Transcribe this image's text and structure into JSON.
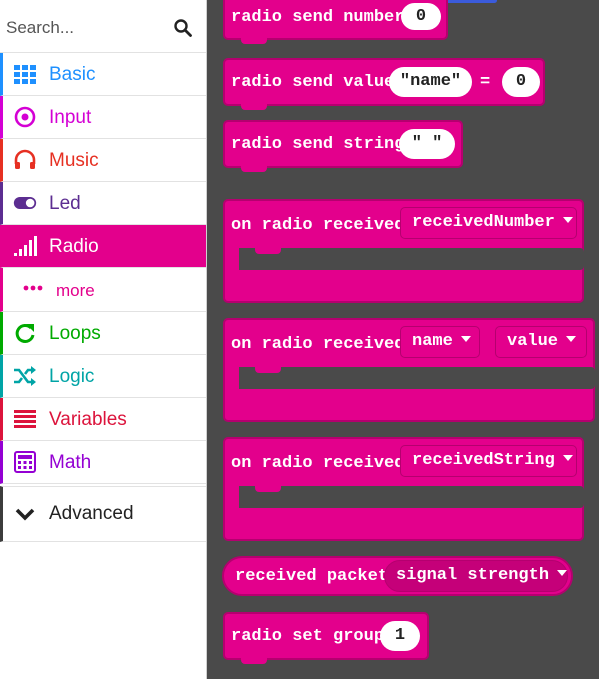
{
  "toolbox": {
    "search_placeholder": "Search...",
    "categories": [
      {
        "label": "Basic",
        "color": "#1e90ff",
        "icon": "grid-icon"
      },
      {
        "label": "Input",
        "color": "#d400d4",
        "icon": "target-icon"
      },
      {
        "label": "Music",
        "color": "#e63022",
        "icon": "headphones-icon"
      },
      {
        "label": "Led",
        "color": "#5c2d91",
        "icon": "toggle-icon"
      },
      {
        "label": "Radio",
        "color": "#e3008c",
        "icon": "signal-bars-icon"
      },
      {
        "label": "more",
        "color": "#e3008c",
        "icon": "dots-icon"
      },
      {
        "label": "Loops",
        "color": "#00aa00",
        "icon": "loop-arrow-icon"
      },
      {
        "label": "Logic",
        "color": "#00a4a6",
        "icon": "shuffle-icon"
      },
      {
        "label": "Variables",
        "color": "#dc143c",
        "icon": "lines-icon"
      },
      {
        "label": "Math",
        "color": "#9400d3",
        "icon": "calculator-icon"
      },
      {
        "label": "Advanced",
        "color": "#222222",
        "icon": "chevron-down-icon"
      }
    ]
  },
  "blocks": {
    "send_number": {
      "text": "radio send number",
      "value": "0"
    },
    "send_value": {
      "text": "radio send value",
      "name": "\"name\"",
      "eq": "=",
      "value": "0"
    },
    "send_string": {
      "text": "radio send string",
      "value": "\" \""
    },
    "received_number": {
      "text": "on radio received",
      "param": "receivedNumber"
    },
    "received_name_value": {
      "text": "on radio received",
      "param1": "name",
      "param2": "value"
    },
    "received_string": {
      "text": "on radio received",
      "param": "receivedString"
    },
    "received_packet": {
      "text": "received packet",
      "param": "signal strength"
    },
    "set_group": {
      "text": "radio set group",
      "value": "1"
    }
  },
  "colors": {
    "radio": "#e3008c",
    "workspace": "#4a4a4a"
  }
}
